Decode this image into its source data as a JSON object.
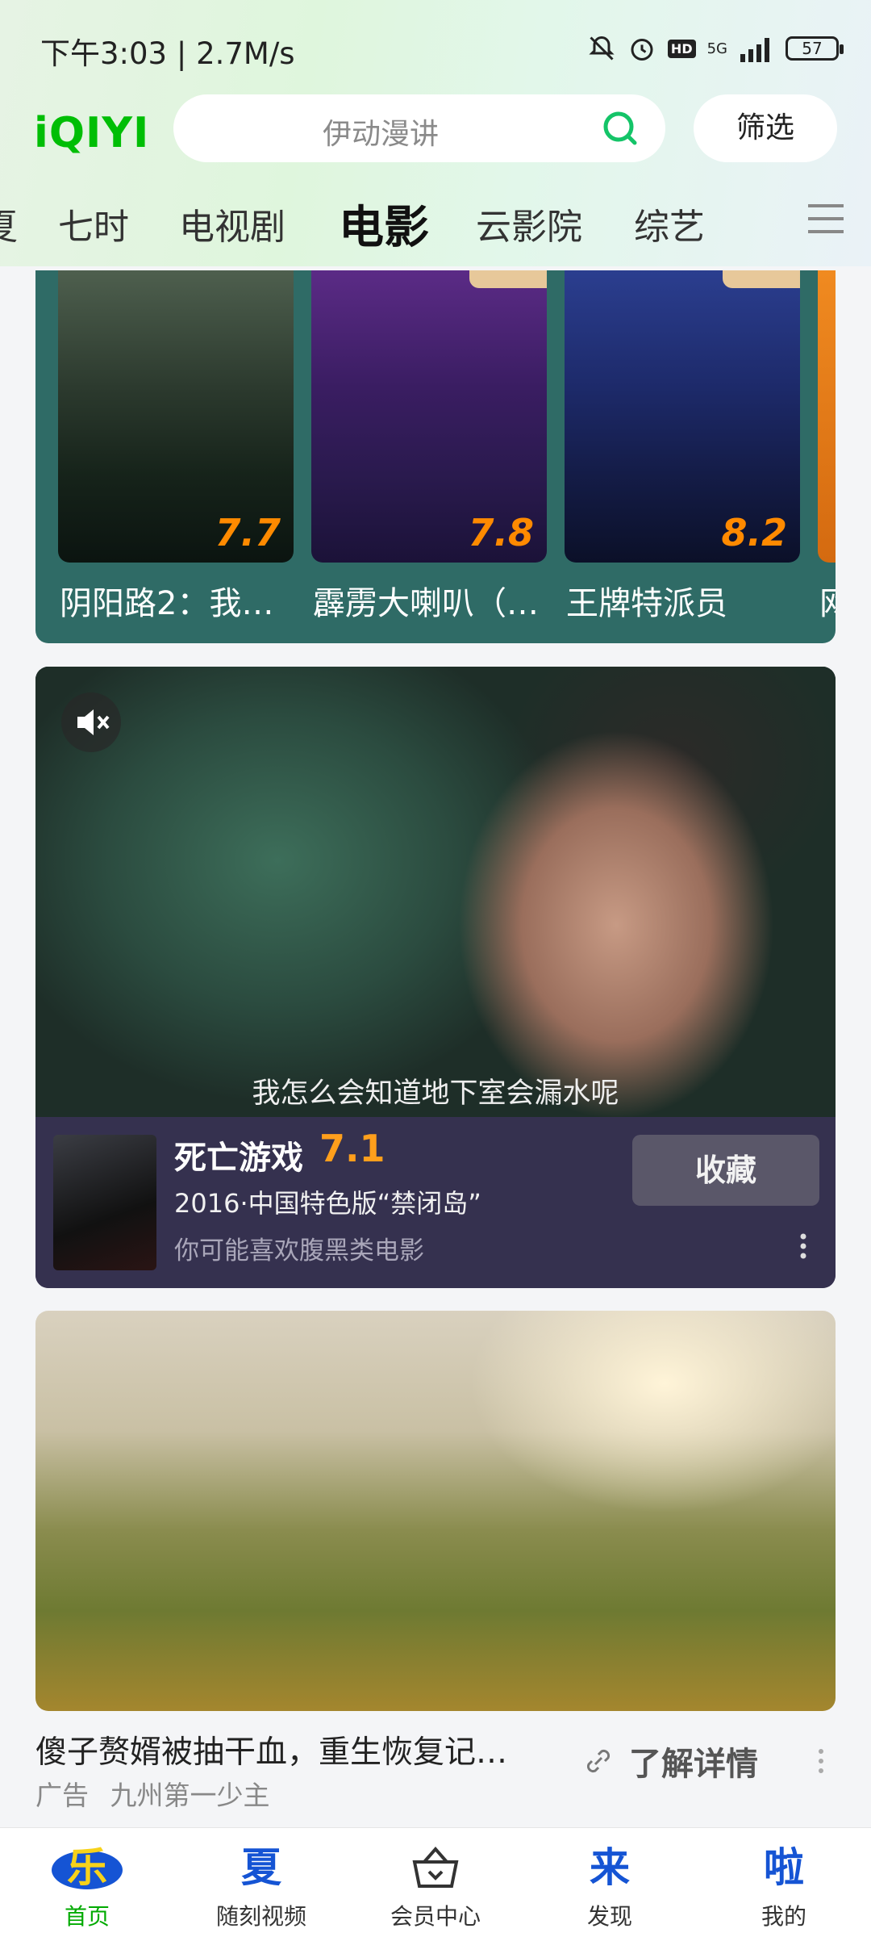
{
  "status": {
    "time": "下午3:03 | 2.7M/s",
    "network": "5G",
    "hd": "HD",
    "battery": "57"
  },
  "header": {
    "logo": "iQIYI",
    "search_placeholder": "伊动漫讲",
    "filter_label": "筛选"
  },
  "tabs": [
    {
      "label": "夏"
    },
    {
      "label": "七时"
    },
    {
      "label": "电视剧"
    },
    {
      "label": "电影"
    },
    {
      "label": "云影院"
    },
    {
      "label": "综艺"
    }
  ],
  "movies_row": [
    {
      "title": "阴阳路2：我…",
      "score": "7.7",
      "vip": false
    },
    {
      "title": "霹雳大喇叭（…",
      "score": "7.8",
      "vip": true
    },
    {
      "title": "王牌特派员",
      "score": "8.2",
      "vip": true
    },
    {
      "title": "网",
      "score": "",
      "vip": false
    }
  ],
  "feature": {
    "subtitle": "我怎么会知道地下室会漏水呢",
    "title": "死亡游戏",
    "score": "7.1",
    "meta": "2016·中国特色版“禁闭岛”",
    "recommend": "你可能喜欢腹黑类电影",
    "collect_label": "收藏"
  },
  "ad": {
    "title": "傻子赘婿被抽干血，重生恢复记…",
    "label": "广告",
    "source": "九州第一少主",
    "detail_label": "了解详情"
  },
  "bottom_nav": [
    {
      "icon_text": "乐",
      "label": "首页"
    },
    {
      "icon_text": "夏",
      "label": "随刻视频"
    },
    {
      "icon_text": "",
      "label": "会员中心"
    },
    {
      "icon_text": "来",
      "label": "发现"
    },
    {
      "icon_text": "啦",
      "label": "我的"
    }
  ],
  "colors": {
    "brand": "#00be06",
    "score": "#ff8a00",
    "card_teal": "#2f6b66",
    "info_bg": "#35314f"
  }
}
